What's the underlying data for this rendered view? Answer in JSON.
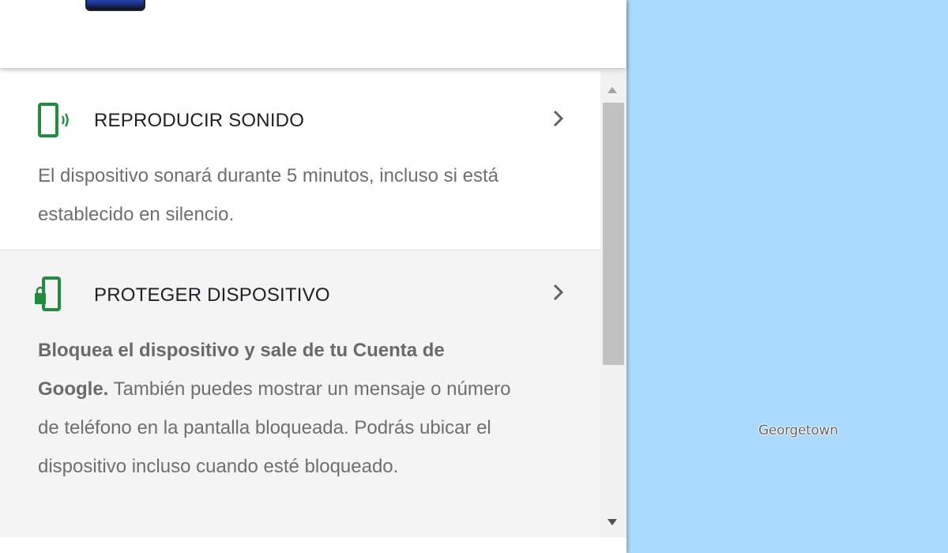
{
  "map": {
    "place_label": "Georgetown",
    "water_color": "#aadaff"
  },
  "actions": [
    {
      "icon": "phone-ringing-icon",
      "title": "REPRODUCIR SONIDO",
      "description": "El dispositivo sonará durante 5 minutos, incluso si está establecido en silencio."
    },
    {
      "icon": "phone-lock-icon",
      "title": "PROTEGER DISPOSITIVO",
      "description_bold": "Bloquea el dispositivo y sale de tu Cuenta de Google.",
      "description": "También puedes mostrar un mensaje o número de teléfono en la pantalla bloqueada. Podrás ubicar el dispositivo incluso cuando esté bloqueado."
    }
  ],
  "colors": {
    "accent_green": "#1e8e3e",
    "selected_bg": "#f4f4f4"
  }
}
